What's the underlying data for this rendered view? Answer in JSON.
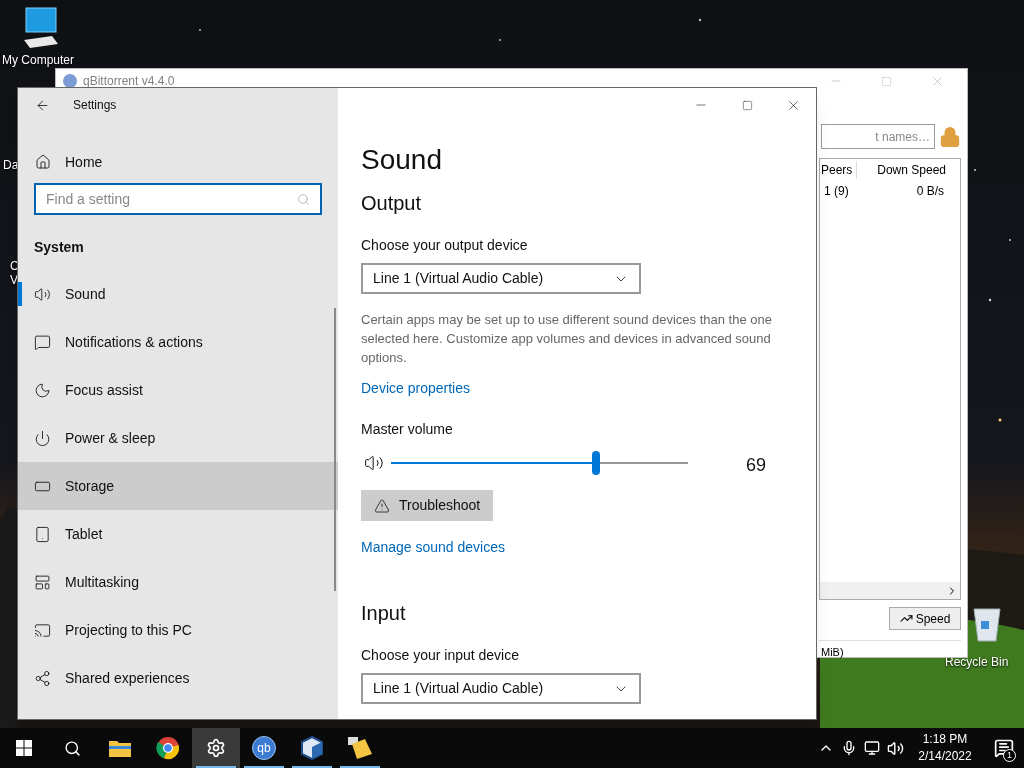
{
  "desktop": {
    "icons": [
      {
        "kind": "computer",
        "label": "My Computer"
      },
      {
        "kind": "recycle",
        "label": "Recycle Bin"
      }
    ],
    "cut_labels": [
      "Da",
      "C",
      "V"
    ]
  },
  "qbittorrent": {
    "title": "qBittorrent v4.4.0",
    "filter_placeholder": "t names…",
    "columns": [
      "Peers",
      "Down Speed"
    ],
    "rows": [
      {
        "peers": "1 (9)",
        "down_speed": "0 B/s"
      }
    ],
    "speed_button": "Speed",
    "status": "MiB)"
  },
  "settings": {
    "title": "Settings",
    "home": "Home",
    "search_placeholder": "Find a setting",
    "section": "System",
    "nav": [
      {
        "kind": "sound",
        "label": "Sound",
        "selected": true,
        "hovered": false
      },
      {
        "kind": "notifications",
        "label": "Notifications & actions",
        "selected": false,
        "hovered": false
      },
      {
        "kind": "focus",
        "label": "Focus assist",
        "selected": false,
        "hovered": false
      },
      {
        "kind": "power",
        "label": "Power & sleep",
        "selected": false,
        "hovered": false
      },
      {
        "kind": "storage",
        "label": "Storage",
        "selected": false,
        "hovered": true
      },
      {
        "kind": "tablet",
        "label": "Tablet",
        "selected": false,
        "hovered": false
      },
      {
        "kind": "multitasking",
        "label": "Multitasking",
        "selected": false,
        "hovered": false
      },
      {
        "kind": "projecting",
        "label": "Projecting to this PC",
        "selected": false,
        "hovered": false
      },
      {
        "kind": "shared",
        "label": "Shared experiences",
        "selected": false,
        "hovered": false
      }
    ],
    "page_title": "Sound",
    "output": {
      "heading": "Output",
      "label": "Choose your output device",
      "device": "Line 1 (Virtual Audio Cable)",
      "description": "Certain apps may be set up to use different sound devices than the one selected here. Customize app volumes and devices in advanced sound options.",
      "link": "Device properties",
      "volume_label": "Master volume",
      "volume": {
        "level": 0.69,
        "reading": "69"
      },
      "troubleshoot": "Troubleshoot",
      "manage_link": "Manage sound devices"
    },
    "input": {
      "heading": "Input",
      "label": "Choose your input device",
      "device": "Line 1 (Virtual Audio Cable)"
    }
  },
  "taskbar": {
    "apps": [
      {
        "kind": "explorer",
        "selected": false,
        "running": false
      },
      {
        "kind": "chrome",
        "selected": false,
        "running": false
      },
      {
        "kind": "settings",
        "selected": true,
        "running": true
      },
      {
        "kind": "qbittorrent",
        "label": "qb",
        "selected": false,
        "running": true
      },
      {
        "kind": "virtualbox",
        "selected": false,
        "running": true
      },
      {
        "kind": "notes",
        "selected": false,
        "running": true
      }
    ],
    "time": "1:18 PM",
    "date": "2/14/2022",
    "notification_count": "1"
  }
}
